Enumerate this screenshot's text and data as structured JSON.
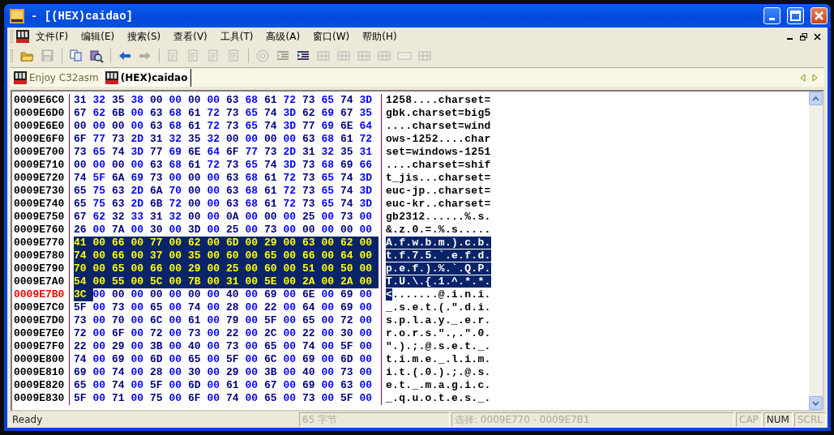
{
  "window": {
    "title": "- [(HEX)caidao]"
  },
  "menu": [
    {
      "label": "文件(F)"
    },
    {
      "label": "编辑(E)"
    },
    {
      "label": "搜索(S)"
    },
    {
      "label": "查看(V)"
    },
    {
      "label": "工具(T)"
    },
    {
      "label": "高级(A)"
    },
    {
      "label": "窗口(W)"
    },
    {
      "label": "帮助(H)"
    }
  ],
  "toolbar": [
    {
      "kind": "open",
      "disabled": false
    },
    {
      "kind": "save",
      "disabled": true
    },
    {
      "kind": "sep"
    },
    {
      "kind": "copy",
      "disabled": false
    },
    {
      "kind": "find",
      "disabled": false
    },
    {
      "kind": "sep"
    },
    {
      "kind": "back",
      "disabled": false
    },
    {
      "kind": "forward",
      "disabled": true
    },
    {
      "kind": "sep"
    },
    {
      "kind": "doc",
      "disabled": true
    },
    {
      "kind": "doc",
      "disabled": true
    },
    {
      "kind": "doc",
      "disabled": true
    },
    {
      "kind": "doc",
      "disabled": true
    },
    {
      "kind": "sep"
    },
    {
      "kind": "disc",
      "disabled": true
    },
    {
      "kind": "lines",
      "disabled": true
    },
    {
      "kind": "lines",
      "disabled": false
    },
    {
      "kind": "grid",
      "disabled": true
    },
    {
      "kind": "grid",
      "disabled": true
    },
    {
      "kind": "grid",
      "disabled": true
    },
    {
      "kind": "grid",
      "disabled": true
    },
    {
      "kind": "panel",
      "disabled": true
    },
    {
      "kind": "grid",
      "disabled": true
    }
  ],
  "tabs": [
    {
      "label": "Enjoy C32asm",
      "selected": false
    },
    {
      "label": "(HEX)caidao",
      "selected": true
    }
  ],
  "hex_rows": [
    {
      "address": "0009E6C0",
      "current": false,
      "selected": false,
      "head_selected": false,
      "bytes": [
        "31",
        "32",
        "35",
        "38",
        "00",
        "00",
        "00",
        "00",
        "63",
        "68",
        "61",
        "72",
        "73",
        "65",
        "74",
        "3D"
      ],
      "ascii": "1258....charset="
    },
    {
      "address": "0009E6D0",
      "current": false,
      "selected": false,
      "head_selected": false,
      "bytes": [
        "67",
        "62",
        "6B",
        "00",
        "63",
        "68",
        "61",
        "72",
        "73",
        "65",
        "74",
        "3D",
        "62",
        "69",
        "67",
        "35"
      ],
      "ascii": "gbk.charset=big5"
    },
    {
      "address": "0009E6E0",
      "current": false,
      "selected": false,
      "head_selected": false,
      "bytes": [
        "00",
        "00",
        "00",
        "00",
        "63",
        "68",
        "61",
        "72",
        "73",
        "65",
        "74",
        "3D",
        "77",
        "69",
        "6E",
        "64"
      ],
      "ascii": "....charset=wind"
    },
    {
      "address": "0009E6F0",
      "current": false,
      "selected": false,
      "head_selected": false,
      "bytes": [
        "6F",
        "77",
        "73",
        "2D",
        "31",
        "32",
        "35",
        "32",
        "00",
        "00",
        "00",
        "00",
        "63",
        "68",
        "61",
        "72"
      ],
      "ascii": "ows-1252....char"
    },
    {
      "address": "0009E700",
      "current": false,
      "selected": false,
      "head_selected": false,
      "bytes": [
        "73",
        "65",
        "74",
        "3D",
        "77",
        "69",
        "6E",
        "64",
        "6F",
        "77",
        "73",
        "2D",
        "31",
        "32",
        "35",
        "31"
      ],
      "ascii": "set=windows-1251"
    },
    {
      "address": "0009E710",
      "current": false,
      "selected": false,
      "head_selected": false,
      "bytes": [
        "00",
        "00",
        "00",
        "00",
        "63",
        "68",
        "61",
        "72",
        "73",
        "65",
        "74",
        "3D",
        "73",
        "68",
        "69",
        "66"
      ],
      "ascii": "....charset=shif"
    },
    {
      "address": "0009E720",
      "current": false,
      "selected": false,
      "head_selected": false,
      "bytes": [
        "74",
        "5F",
        "6A",
        "69",
        "73",
        "00",
        "00",
        "00",
        "63",
        "68",
        "61",
        "72",
        "73",
        "65",
        "74",
        "3D"
      ],
      "ascii": "t_jis...charset="
    },
    {
      "address": "0009E730",
      "current": false,
      "selected": false,
      "head_selected": false,
      "bytes": [
        "65",
        "75",
        "63",
        "2D",
        "6A",
        "70",
        "00",
        "00",
        "63",
        "68",
        "61",
        "72",
        "73",
        "65",
        "74",
        "3D"
      ],
      "ascii": "euc-jp..charset="
    },
    {
      "address": "0009E740",
      "current": false,
      "selected": false,
      "head_selected": false,
      "bytes": [
        "65",
        "75",
        "63",
        "2D",
        "6B",
        "72",
        "00",
        "00",
        "63",
        "68",
        "61",
        "72",
        "73",
        "65",
        "74",
        "3D"
      ],
      "ascii": "euc-kr..charset="
    },
    {
      "address": "0009E750",
      "current": false,
      "selected": false,
      "head_selected": false,
      "bytes": [
        "67",
        "62",
        "32",
        "33",
        "31",
        "32",
        "00",
        "00",
        "0A",
        "00",
        "00",
        "00",
        "25",
        "00",
        "73",
        "00"
      ],
      "ascii": "gb2312......%.s."
    },
    {
      "address": "0009E760",
      "current": false,
      "selected": false,
      "head_selected": false,
      "bytes": [
        "26",
        "00",
        "7A",
        "00",
        "30",
        "00",
        "3D",
        "00",
        "25",
        "00",
        "73",
        "00",
        "00",
        "00",
        "00",
        "00"
      ],
      "ascii": "&.z.0.=.%.s....."
    },
    {
      "address": "0009E770",
      "current": false,
      "selected": true,
      "head_selected": true,
      "bytes": [
        "41",
        "00",
        "66",
        "00",
        "77",
        "00",
        "62",
        "00",
        "6D",
        "00",
        "29",
        "00",
        "63",
        "00",
        "62",
        "00"
      ],
      "ascii": "A.f.w.b.m.).c.b."
    },
    {
      "address": "0009E780",
      "current": false,
      "selected": true,
      "head_selected": true,
      "bytes": [
        "74",
        "00",
        "66",
        "00",
        "37",
        "00",
        "35",
        "00",
        "60",
        "00",
        "65",
        "00",
        "66",
        "00",
        "64",
        "00"
      ],
      "ascii": "t.f.7.5.`.e.f.d."
    },
    {
      "address": "0009E790",
      "current": false,
      "selected": true,
      "head_selected": true,
      "bytes": [
        "70",
        "00",
        "65",
        "00",
        "66",
        "00",
        "29",
        "00",
        "25",
        "00",
        "60",
        "00",
        "51",
        "00",
        "50",
        "00"
      ],
      "ascii": "p.e.f.).%.`.Q.P."
    },
    {
      "address": "0009E7A0",
      "current": false,
      "selected": true,
      "head_selected": true,
      "bytes": [
        "54",
        "00",
        "55",
        "00",
        "5C",
        "00",
        "7B",
        "00",
        "31",
        "00",
        "5E",
        "00",
        "2A",
        "00",
        "2A",
        "00"
      ],
      "ascii": "T.U.\\.{.1.^.*.*."
    },
    {
      "address": "0009E7B0",
      "current": true,
      "selected": false,
      "head_selected": true,
      "bytes": [
        "3C",
        "00",
        "00",
        "00",
        "00",
        "00",
        "00",
        "00",
        "40",
        "00",
        "69",
        "00",
        "6E",
        "00",
        "69",
        "00"
      ],
      "ascii": "<.......@.i.n.i."
    },
    {
      "address": "0009E7C0",
      "current": false,
      "selected": false,
      "head_selected": false,
      "bytes": [
        "5F",
        "00",
        "73",
        "00",
        "65",
        "00",
        "74",
        "00",
        "28",
        "00",
        "22",
        "00",
        "64",
        "00",
        "69",
        "00"
      ],
      "ascii": "_.s.e.t.(.\".d.i."
    },
    {
      "address": "0009E7D0",
      "current": false,
      "selected": false,
      "head_selected": false,
      "bytes": [
        "73",
        "00",
        "70",
        "00",
        "6C",
        "00",
        "61",
        "00",
        "79",
        "00",
        "5F",
        "00",
        "65",
        "00",
        "72",
        "00"
      ],
      "ascii": "s.p.l.a.y._.e.r."
    },
    {
      "address": "0009E7E0",
      "current": false,
      "selected": false,
      "head_selected": false,
      "bytes": [
        "72",
        "00",
        "6F",
        "00",
        "72",
        "00",
        "73",
        "00",
        "22",
        "00",
        "2C",
        "00",
        "22",
        "00",
        "30",
        "00"
      ],
      "ascii": "r.o.r.s.\".,.\".0."
    },
    {
      "address": "0009E7F0",
      "current": false,
      "selected": false,
      "head_selected": false,
      "bytes": [
        "22",
        "00",
        "29",
        "00",
        "3B",
        "00",
        "40",
        "00",
        "73",
        "00",
        "65",
        "00",
        "74",
        "00",
        "5F",
        "00"
      ],
      "ascii": "\".).;.@.s.e.t._."
    },
    {
      "address": "0009E800",
      "current": false,
      "selected": false,
      "head_selected": false,
      "bytes": [
        "74",
        "00",
        "69",
        "00",
        "6D",
        "00",
        "65",
        "00",
        "5F",
        "00",
        "6C",
        "00",
        "69",
        "00",
        "6D",
        "00"
      ],
      "ascii": "t.i.m.e._.l.i.m."
    },
    {
      "address": "0009E810",
      "current": false,
      "selected": false,
      "head_selected": false,
      "bytes": [
        "69",
        "00",
        "74",
        "00",
        "28",
        "00",
        "30",
        "00",
        "29",
        "00",
        "3B",
        "00",
        "40",
        "00",
        "73",
        "00"
      ],
      "ascii": "i.t.(.0.).;.@.s."
    },
    {
      "address": "0009E820",
      "current": false,
      "selected": false,
      "head_selected": false,
      "bytes": [
        "65",
        "00",
        "74",
        "00",
        "5F",
        "00",
        "6D",
        "00",
        "61",
        "00",
        "67",
        "00",
        "69",
        "00",
        "63",
        "00"
      ],
      "ascii": "e.t._.m.a.g.i.c."
    },
    {
      "address": "0009E830",
      "current": false,
      "selected": false,
      "head_selected": false,
      "bytes": [
        "5F",
        "00",
        "71",
        "00",
        "75",
        "00",
        "6F",
        "00",
        "74",
        "00",
        "65",
        "00",
        "73",
        "00",
        "5F",
        "00"
      ],
      "ascii": "_.q.u.o.t.e.s._."
    }
  ],
  "status_bar": {
    "message": "Ready",
    "size": "65 字节",
    "selection": "选择: 0009E770 - 0009E7B1",
    "indicators": [
      {
        "label": "CAP",
        "on": false
      },
      {
        "label": "NUM",
        "on": true
      },
      {
        "label": "SCRL",
        "on": false
      }
    ]
  }
}
